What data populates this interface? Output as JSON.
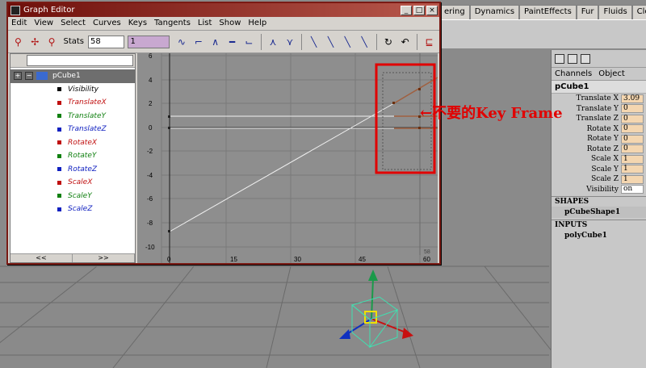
{
  "shelf": {
    "tabs": [
      "ering",
      "Dynamics",
      "PaintEffects",
      "Fur",
      "Fluids",
      "Cloth"
    ]
  },
  "graph_editor": {
    "title": "Graph Editor",
    "title_buttons": [
      "_",
      "□",
      "×"
    ],
    "menu": [
      "Edit",
      "View",
      "Select",
      "Curves",
      "Keys",
      "Tangents",
      "List",
      "Show",
      "Help"
    ],
    "stats_label": "Stats",
    "stats_time": "58",
    "stats_value": "1",
    "outliner": {
      "object": "pCube1",
      "channels": [
        {
          "label": "Visibility",
          "color": "#000000"
        },
        {
          "label": "TranslateX",
          "color": "#c01010"
        },
        {
          "label": "TranslateY",
          "color": "#108010"
        },
        {
          "label": "TranslateZ",
          "color": "#1020c0"
        },
        {
          "label": "RotateX",
          "color": "#c01010"
        },
        {
          "label": "RotateY",
          "color": "#108010"
        },
        {
          "label": "RotateZ",
          "color": "#1020c0"
        },
        {
          "label": "ScaleX",
          "color": "#c01010"
        },
        {
          "label": "ScaleY",
          "color": "#108010"
        },
        {
          "label": "ScaleZ",
          "color": "#1020c0"
        }
      ],
      "scroll_left": "<<",
      "scroll_right": ">>"
    },
    "graph": {
      "y_ticks": [
        "6",
        "4",
        "2",
        "0",
        "-2",
        "-4",
        "-6",
        "-8",
        "-10"
      ],
      "x_ticks": [
        "0",
        "15",
        "30",
        "45",
        "60"
      ],
      "current_frame_label": "58"
    }
  },
  "annotation": "←不要的Key Frame",
  "channel_box": {
    "menu": [
      "Channels",
      "Object"
    ],
    "object": "pCube1",
    "attributes": [
      {
        "label": "Translate X",
        "value": "3.09"
      },
      {
        "label": "Translate Y",
        "value": "0"
      },
      {
        "label": "Translate Z",
        "value": "0"
      },
      {
        "label": "Rotate X",
        "value": "0"
      },
      {
        "label": "Rotate Y",
        "value": "0"
      },
      {
        "label": "Rotate Z",
        "value": "0"
      },
      {
        "label": "Scale X",
        "value": "1"
      },
      {
        "label": "Scale Y",
        "value": "1"
      },
      {
        "label": "Scale Z",
        "value": "1"
      },
      {
        "label": "Visibility",
        "value": "on"
      }
    ],
    "shapes_header": "SHAPES",
    "shape_node": "pCubeShape1",
    "inputs_header": "INPUTS",
    "input_node": "polyCube1"
  },
  "colors": {
    "title_bar": "#6e0f0a",
    "annotation": "#e10000",
    "keyed_field": "#f4d6b0"
  }
}
